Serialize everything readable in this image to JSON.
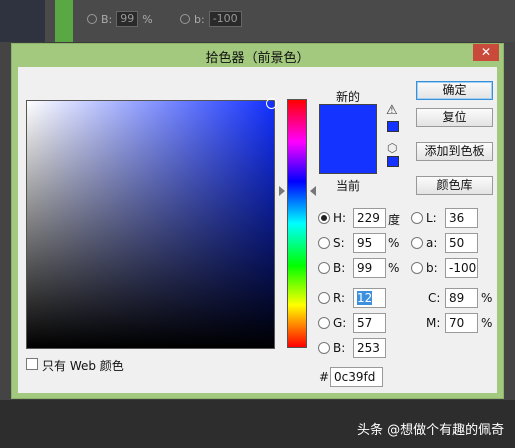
{
  "background": {
    "row1": {
      "label": "B:",
      "value": "99",
      "unit": "%"
    },
    "row2": {
      "label": "b:",
      "value": "-100"
    }
  },
  "dialog": {
    "title": "拾色器（前景色）",
    "close_glyph": "✕",
    "new_label": "新的",
    "current_label": "当前",
    "swatch_color": "#1433ff",
    "buttons": {
      "ok": "确定",
      "reset": "复位",
      "add_swatch": "添加到色板",
      "libraries": "颜色库"
    },
    "web_only_label": "只有 Web 颜色",
    "fields": {
      "H": {
        "label": "H:",
        "value": "229",
        "unit": "度"
      },
      "S": {
        "label": "S:",
        "value": "95",
        "unit": "%"
      },
      "B": {
        "label": "B:",
        "value": "99",
        "unit": "%"
      },
      "R": {
        "label": "R:",
        "value": "12"
      },
      "G": {
        "label": "G:",
        "value": "57"
      },
      "B2": {
        "label": "B:",
        "value": "253"
      },
      "L": {
        "label": "L:",
        "value": "36"
      },
      "a": {
        "label": "a:",
        "value": "50"
      },
      "b": {
        "label": "b:",
        "value": "-100"
      },
      "C": {
        "label": "C:",
        "value": "89",
        "unit": "%"
      },
      "M": {
        "label": "M:",
        "value": "70",
        "unit": "%"
      }
    },
    "hex_label": "#",
    "hex_value": "0c39fd"
  },
  "watermark": "头条 @想做个有趣的佩奇"
}
